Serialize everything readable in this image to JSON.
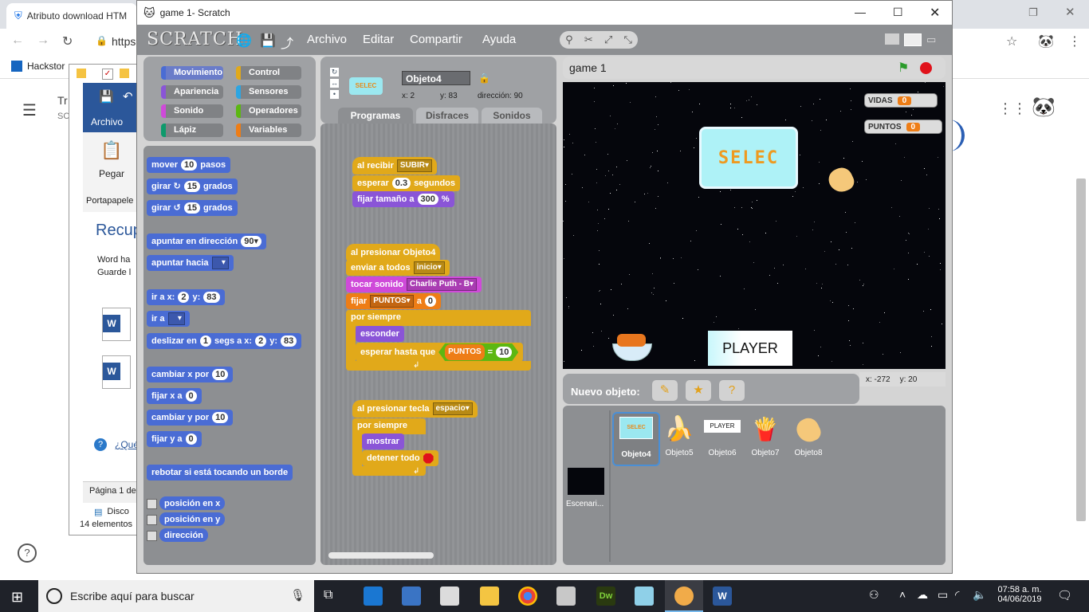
{
  "chrome": {
    "tab_title": "Atributo download HTM",
    "url_fragment": "https",
    "bookmark": "Hackstor",
    "page_text_1": "Tr",
    "page_text_2": "SC"
  },
  "word": {
    "ribbon_tab": "Archivo",
    "paste_label": "Pegar",
    "clipboard_label": "Portapapele",
    "recover_heading": "Recup",
    "recover_line1": "Word ha",
    "recover_line2": "Guarde l",
    "help_link": "¿Qué",
    "status": "Página 1 de",
    "explorer_item": "Disco",
    "explorer_count": "14 elementos"
  },
  "scratch": {
    "window_title": "game 1- Scratch",
    "logo": "SCRATCH",
    "menu": [
      "Archivo",
      "Editar",
      "Compartir",
      "Ayuda"
    ],
    "categories": {
      "motion": "Movimiento",
      "looks": "Apariencia",
      "sound": "Sonido",
      "pen": "Lápiz",
      "control": "Control",
      "sensing": "Sensores",
      "operators": "Operadores",
      "variables": "Variables"
    },
    "palette": {
      "move": "mover",
      "move_n": "10",
      "move_steps": "pasos",
      "turn_cw": "girar ↻",
      "turn_cw_n": "15",
      "degrees": "grados",
      "turn_ccw": "girar ↺",
      "turn_ccw_n": "15",
      "point_dir": "apuntar en dirección",
      "point_dir_val": "90▾",
      "point_towards": "apuntar hacia",
      "goto_xy": "ir a x:",
      "goto_x": "2",
      "goto_y_label": "y:",
      "goto_y": "83",
      "goto": "ir a",
      "glide": "deslizar en",
      "glide_secs": "1",
      "glide_mid": "segs a x:",
      "glide_x": "2",
      "glide_y_label": "y:",
      "glide_y": "83",
      "change_x": "cambiar x por",
      "change_x_n": "10",
      "set_x": "fijar x a",
      "set_x_n": "0",
      "change_y": "cambiar y por",
      "change_y_n": "10",
      "set_y": "fijar y a",
      "set_y_n": "0",
      "bounce": "rebotar si está tocando un borde",
      "rep_x": "posición en x",
      "rep_y": "posición en y",
      "rep_dir": "dirección"
    },
    "sprite_info": {
      "name": "Objeto4",
      "x_label": "x: 2",
      "y_label": "y: 83",
      "dir_label": "dirección: 90"
    },
    "tabs": [
      "Programas",
      "Disfraces",
      "Sonidos"
    ],
    "scripts": {
      "s1_hat": "al recibir",
      "s1_msg": "SUBIR▾",
      "s1_wait": "esperar",
      "s1_wait_n": "0.3",
      "s1_wait_unit": "segundos",
      "s1_size": "fijar tamaño a",
      "s1_size_n": "300",
      "s1_size_unit": "%",
      "s2_hat": "al presionar Objeto4",
      "s2_broadcast": "enviar a todos",
      "s2_broadcast_msg": "inicio▾",
      "s2_sound": "tocar sonido",
      "s2_sound_name": "Charlie Puth - B▾",
      "s2_set": "fijar",
      "s2_set_var": "PUNTOS▾",
      "s2_set_to": "a",
      "s2_set_n": "0",
      "s2_forever": "por siempre",
      "s2_hide": "esconder",
      "s2_waituntil": "esperar hasta que",
      "s2_cond_var": "PUNTOS",
      "s2_cond_op": "=",
      "s2_cond_n": "10",
      "s3_hat": "al presionar tecla",
      "s3_key": "espacio▾",
      "s3_forever": "por siempre",
      "s3_show": "mostrar",
      "s3_stop": "detener todo"
    },
    "stage": {
      "title": "game 1",
      "vidas_label": "VIDAS",
      "vidas_value": "0",
      "puntos_label": "PUNTOS",
      "puntos_value": "0",
      "select_sprite_text": "SELEC",
      "player_text": "PLAYER",
      "mouse_x": "x: -272",
      "mouse_y": "y: 20"
    },
    "new_sprite_label": "Nuevo objeto:",
    "sprites": [
      {
        "name": "Objeto4",
        "icon": "selec-thumb"
      },
      {
        "name": "Objeto5",
        "icon": "banana"
      },
      {
        "name": "Objeto6",
        "icon": "player-thumb"
      },
      {
        "name": "Objeto7",
        "icon": "bowl-of-fries"
      },
      {
        "name": "Objeto8",
        "icon": "fortune-cookie"
      }
    ],
    "stage_thumb_label": "Escenari..."
  },
  "taskbar": {
    "search_placeholder": "Escribe aquí para buscar",
    "time": "07:58 a. m.",
    "date": "04/06/2019"
  }
}
